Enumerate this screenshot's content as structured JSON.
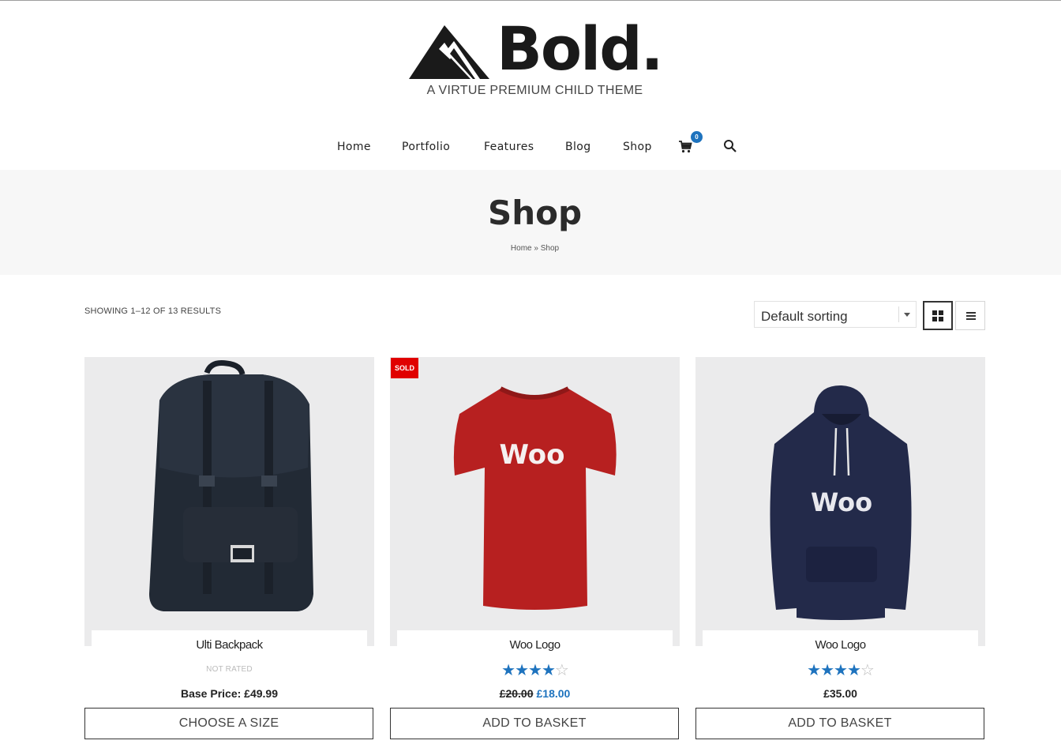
{
  "site": {
    "logo_text": "Bold.",
    "tagline": "A VIRTUE PREMIUM CHILD THEME"
  },
  "nav": {
    "items": [
      {
        "label": "Home"
      },
      {
        "label": "Portfolio"
      },
      {
        "label": "Features"
      },
      {
        "label": "Blog"
      },
      {
        "label": "Shop"
      }
    ],
    "cart_count": "0",
    "cart_icon": "cart-icon",
    "search_icon": "search-icon"
  },
  "page": {
    "title": "Shop",
    "breadcrumb": "Home » Shop"
  },
  "toolbar": {
    "result_count": "SHOWING 1–12 OF 13 RESULTS",
    "sort_value": "Default sorting",
    "view_grid_icon": "grid-view-icon",
    "view_list_icon": "list-view-icon"
  },
  "colors": {
    "accent": "#1e73be",
    "sale": "#e00000",
    "band": "#f7f7f7"
  },
  "products": [
    {
      "title": "Ulti Backpack",
      "rating_text": "NOT RATED",
      "price": "Base Price: £49.99",
      "button": "CHOOSE A SIZE",
      "image": "backpack-image"
    },
    {
      "title": "Woo Logo",
      "badge": "SOLD",
      "rating": 4,
      "rating_max": 5,
      "price_old": "£20.00",
      "price_new": "£18.00",
      "button": "ADD TO BASKET",
      "image_text": "Woo",
      "image": "red-tshirt-image"
    },
    {
      "title": "Woo Logo",
      "rating": 4,
      "rating_max": 5,
      "price": "£35.00",
      "button": "ADD TO BASKET",
      "image_text": "Woo",
      "image": "navy-hoodie-image"
    }
  ]
}
